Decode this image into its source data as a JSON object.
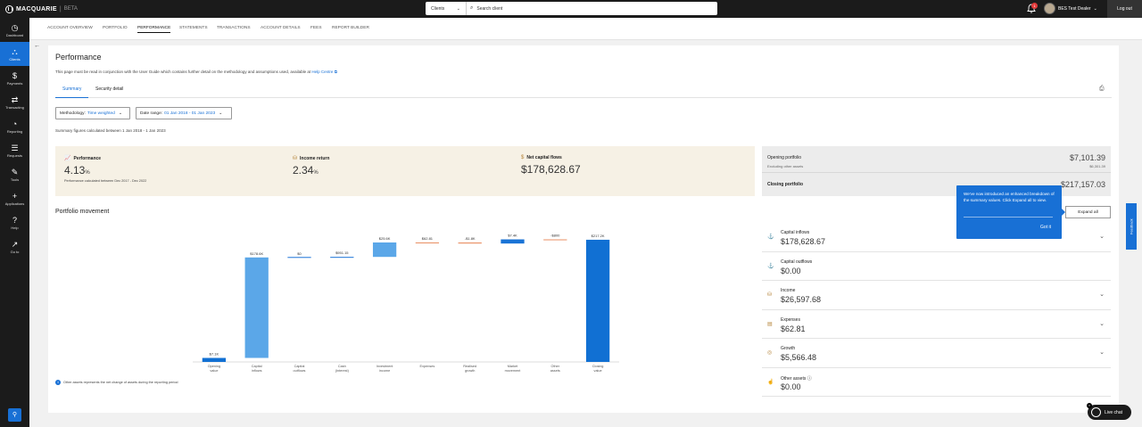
{
  "brand": {
    "name": "MACQUARIE",
    "tag": "BETA"
  },
  "search": {
    "type": "Clients",
    "placeholder": "Search client"
  },
  "notifications": {
    "count": "1"
  },
  "user": {
    "name": "BES Test Dealer"
  },
  "logout": "Log out",
  "sidebar": {
    "items": [
      {
        "label": "Dashboard",
        "icon": "◷"
      },
      {
        "label": "Clients",
        "icon": "⛬"
      },
      {
        "label": "Payments",
        "icon": "$"
      },
      {
        "label": "Transacting",
        "icon": "⇄"
      },
      {
        "label": "Reporting",
        "icon": "◔"
      },
      {
        "label": "Requests",
        "icon": "☰"
      },
      {
        "label": "Tools",
        "icon": "✎"
      },
      {
        "label": "Applications",
        "icon": "+"
      },
      {
        "label": "Help",
        "icon": "?"
      },
      {
        "label": "Go to",
        "icon": "↗"
      }
    ],
    "pin_icon": "📌"
  },
  "nav": {
    "tabs": [
      "ACCOUNT OVERVIEW",
      "PORTFOLIO",
      "PERFORMANCE",
      "STATEMENTS",
      "TRANSACTIONS",
      "ACCOUNT DETAILS",
      "FEES",
      "REPORT BUILDER"
    ],
    "active": "PERFORMANCE"
  },
  "page": {
    "title": "Performance",
    "disclaimer": "This page must be read in conjunction with the User Guide which contains further detail on the methodology and assumptions used, available at ",
    "help_link": "Help Centre",
    "subtabs": [
      "Summary",
      "Security detail"
    ],
    "methodology_label": "Methodology:",
    "methodology_value": "Time weighted",
    "date_label": "Date range:",
    "date_value": "01 Jan 2018 - 01 Jan 2023",
    "summary_note": "Summary figures calculated between 1 Jan 2018 - 1 Jan 2023"
  },
  "kpis": {
    "performance": {
      "label": "Performance",
      "value": "4.13",
      "unit": "%",
      "note": "Performance calculated between Dec 2017 - Dec 2022"
    },
    "income": {
      "label": "Income return",
      "value": "2.34",
      "unit": "%"
    },
    "netflows": {
      "label": "Net capital flows",
      "value": "$178,628.67"
    }
  },
  "portfolio": {
    "opening_label": "Opening portfolio",
    "opening_value": "$7,101.39",
    "excluding_label": "Excluding other assets",
    "excluding_value": "$6,301.39",
    "closing_label": "Closing portfolio",
    "closing_value": "$217,157.03"
  },
  "tooltip": {
    "text": "We've now introduced an enhanced breakdown of the summary values. Click Expand all to view.",
    "button": "Got it"
  },
  "expand_all": "Expand all",
  "breakdown": [
    {
      "label": "Capital inflows",
      "value": "$178,628.67",
      "icon": "⚓",
      "expandable": true
    },
    {
      "label": "Capital outflows",
      "value": "$0.00",
      "icon": "⚓",
      "expandable": false
    },
    {
      "label": "Income",
      "value": "$26,597.68",
      "icon": "⛁",
      "expandable": true
    },
    {
      "label": "Expenses",
      "value": "$62.81",
      "icon": "▤",
      "expandable": true
    },
    {
      "label": "Growth",
      "value": "$5,566.48",
      "icon": "◎",
      "expandable": true
    },
    {
      "label": "Other assets ⓘ",
      "value": "$0.00",
      "icon": "☝",
      "expandable": false
    }
  ],
  "chart_title": "Portfolio movement",
  "other_note": "Other assets represents the net change of assets during the reporting period",
  "chart_data": {
    "type": "bar",
    "subtype": "waterfall",
    "title": "Portfolio movement",
    "categories": [
      "Opening value",
      "Capital inflows",
      "Capital outflows",
      "Cash (Interest)",
      "Investment income",
      "Expenses",
      "Realised growth",
      "Market movement",
      "Other assets",
      "Closing value"
    ],
    "data_labels": [
      "$7.1K",
      "$178.6K",
      "$0",
      "$951.15",
      "$25.6K",
      "$62.81",
      "-$1.8K",
      "$7.4K",
      "-$800",
      "$217.2K"
    ],
    "values": [
      7101.39,
      178628.67,
      0,
      951.15,
      25646.53,
      -62.81,
      -1800,
      7366.48,
      -800,
      217157.03
    ],
    "kinds": [
      "total",
      "increase",
      "increase",
      "increase",
      "increase",
      "decrease",
      "decrease",
      "increase",
      "decrease",
      "total"
    ],
    "ylim": [
      0,
      225000
    ],
    "colors": {
      "total": "#1170d3",
      "increase": "#5ba7e8",
      "decrease": "#e98f63",
      "small_increase": "#1a73d6"
    }
  },
  "feedback": "Feedback",
  "live_chat": "Live chat"
}
